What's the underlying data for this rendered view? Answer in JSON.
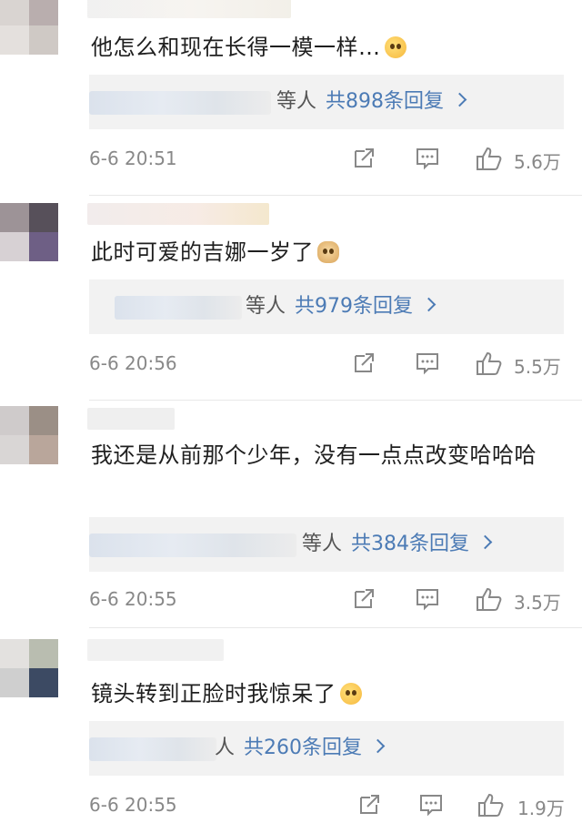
{
  "comments": [
    {
      "text": "他怎么和现在长得一模一样…",
      "emoji": "astonished-emoji",
      "reply_who": "等人",
      "reply_count": "共898条回复",
      "time": "6-6 20:51",
      "likes": "5.6万"
    },
    {
      "text": "此时可爱的吉娜一岁了",
      "emoji": "doge-emoji",
      "reply_who": "等人",
      "reply_count": "共979条回复",
      "time": "6-6 20:56",
      "likes": "5.5万"
    },
    {
      "text": "我还是从前那个少年，没有一点点改变哈哈哈",
      "emoji": "",
      "reply_who": "等人",
      "reply_count": "共384条回复",
      "time": "6-6 20:55",
      "likes": "3.5万"
    },
    {
      "text": "镜头转到正脸时我惊呆了",
      "emoji": "astonished-emoji",
      "reply_who": "人",
      "reply_count": "共260条回复",
      "time": "6-6 20:55",
      "likes": "1.9万"
    }
  ],
  "icons": {
    "share": "share-icon",
    "comment": "comment-icon",
    "like": "like-icon"
  },
  "colors": {
    "link": "#4c7bb5",
    "meta": "#888888",
    "reply_bg": "#f2f2f2"
  }
}
